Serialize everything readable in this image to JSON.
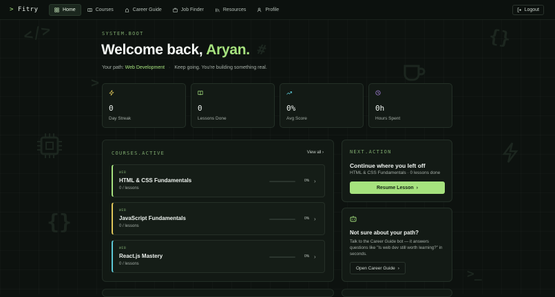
{
  "nav": {
    "logo": "Fitry",
    "logo_icon": "chevron-right-icon",
    "links": [
      {
        "label": "Home",
        "icon": "home-icon",
        "active": true
      },
      {
        "label": "Courses",
        "icon": "book-icon"
      },
      {
        "label": "Career Guide",
        "icon": "compass-icon"
      },
      {
        "label": "Job Finder",
        "icon": "briefcase-icon"
      },
      {
        "label": "Resources",
        "icon": "library-icon"
      },
      {
        "label": "Profile",
        "icon": "user-icon"
      }
    ],
    "logout": "Logout"
  },
  "hero": {
    "tag": "SYSTEM.BOOT",
    "welcome": "Welcome back,",
    "name": "Aryan.",
    "path_label": "Your path:",
    "path_value": "Web Development",
    "separator": "·",
    "path_msg": "Keep going. You're building something real."
  },
  "stats": [
    {
      "value": "0",
      "label": "Day Streak",
      "icon": "zap-icon",
      "color": "#e0c75a"
    },
    {
      "value": "0",
      "label": "Lessons Done",
      "icon": "book-open-icon",
      "color": "#a6e27e"
    },
    {
      "value": "0%",
      "label": "Avg Score",
      "icon": "trending-up-icon",
      "color": "#5cc8d6"
    },
    {
      "value": "0h",
      "label": "Hours Spent",
      "icon": "clock-icon",
      "color": "#b48cf0"
    }
  ],
  "courses": {
    "title": "COURSES.ACTIVE",
    "view_all": "View all",
    "items": [
      {
        "tag": "WEB",
        "title": "HTML & CSS Fundamentals",
        "sub": "0 / lessons",
        "progress": "0%",
        "accent": "#a6e27e"
      },
      {
        "tag": "WEB",
        "title": "JavaScript Fundamentals",
        "sub": "0 / lessons",
        "progress": "0%",
        "accent": "#e0c75a"
      },
      {
        "tag": "WEB",
        "title": "React.js Mastery",
        "sub": "0 / lessons",
        "progress": "0%",
        "accent": "#5cc8d6"
      }
    ]
  },
  "next_action": {
    "tag": "NEXT.ACTION",
    "title": "Continue where you left off",
    "sub": "HTML & CSS Fundamentals · 0 lessons done",
    "button": "Resume Lesson"
  },
  "guide": {
    "icon": "bot-icon",
    "title": "Not sure about your path?",
    "body": "Talk to the Career Guide bot — it answers questions like \"Is web dev still worth learning?\" in seconds.",
    "button": "Open Career Guide"
  },
  "colors": {
    "accent": "#a6e27e",
    "background": "#0d120f"
  }
}
